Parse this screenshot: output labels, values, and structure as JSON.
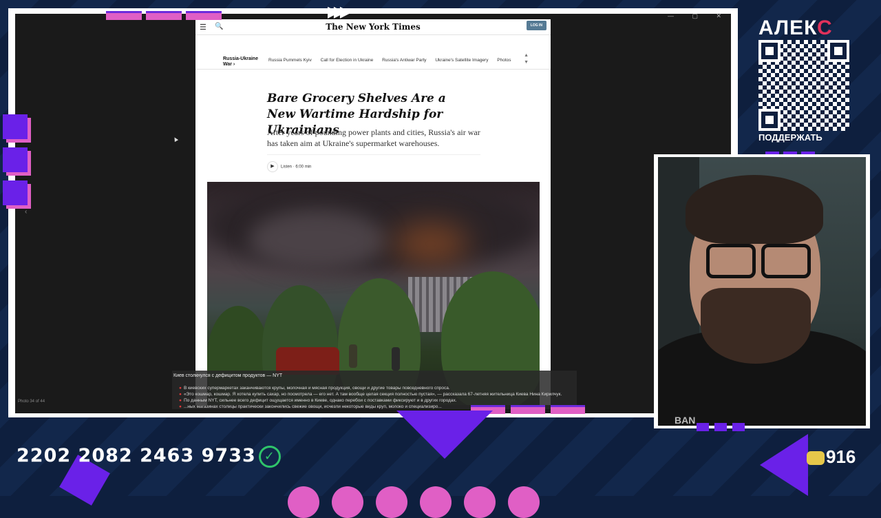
{
  "browser": {
    "window_controls": "— ▢ ✕",
    "photo_counter": "Photo 34 of 44",
    "left_arrow": "‹"
  },
  "article": {
    "logo": "The New York Times",
    "login_label": "LOG IN",
    "section": "Russia-Ukraine War ›",
    "nav_links": [
      "Russia Pummels Kyiv",
      "Call for Election in Ukraine",
      "Russia's Antiwar Party",
      "Ukraine's Satellite Imagery",
      "Photos"
    ],
    "headline": "Bare Grocery Shelves Are a New Wartime Hardship for Ukrainians",
    "dek": "After years of pounding power plants and cities, Russia's air war has taken aim at Ukraine's supermarket warehouses.",
    "listen_label": "Listen · 6:00 min"
  },
  "caption": {
    "title": "Киев столкнулся с дефицитом продуктов — NYT",
    "lines": [
      "В киевских супермаркетах заканчиваются крупы, молочная и мясная продукция, овощи и другие товары повседневного спроса.",
      "«Это кошмар, кошмар. Я хотела купить сахар, но посмотрела — его нет. А там вообще целая секция полностью пустая», — рассказала 67-летняя жительница Киева Нина Кирилчук.",
      "По данным NYT, сильнее всего дефицит ощущается именно в Киеве, однако перебои с поставками фиксируют и в других городах.",
      "...ных магазинах столицы практически закончились свежие овощи, исчезли некоторые виды круп, молоко и специализиро..."
    ]
  },
  "stream": {
    "qr_title_a": "АЛЕК",
    "qr_title_b": "С",
    "support_label": "ПОДДЕРЖАТЬ",
    "card_number": "2202 2082 2463 9733",
    "counter": "916",
    "shirt_text": "BAN"
  }
}
